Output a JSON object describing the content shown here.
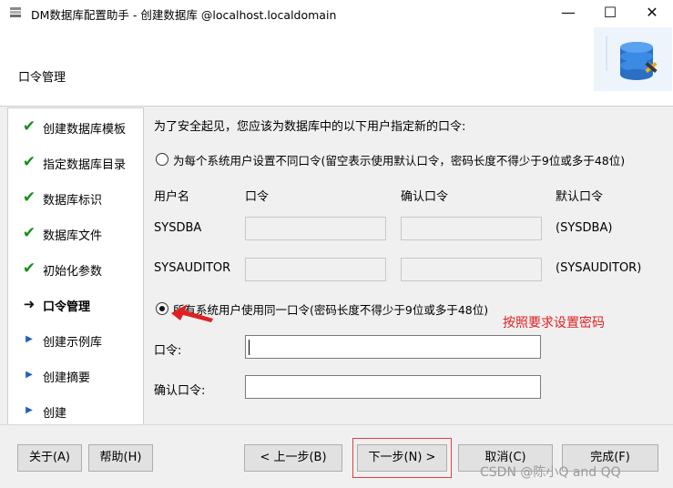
{
  "window": {
    "title": "DM数据库配置助手 - 创建数据库 @localhost.localdomain",
    "minimize": "—",
    "maximize": "☐",
    "close": "✕"
  },
  "header": {
    "title": "口令管理"
  },
  "sidebar": {
    "items": [
      {
        "label": "创建数据库模板",
        "state": "done"
      },
      {
        "label": "指定数据库目录",
        "state": "done"
      },
      {
        "label": "数据库标识",
        "state": "done"
      },
      {
        "label": "数据库文件",
        "state": "done"
      },
      {
        "label": "初始化参数",
        "state": "done"
      },
      {
        "label": "口令管理",
        "state": "current"
      },
      {
        "label": "创建示例库",
        "state": "pending"
      },
      {
        "label": "创建摘要",
        "state": "pending"
      },
      {
        "label": "创建",
        "state": "pending"
      }
    ]
  },
  "main": {
    "intro": "为了安全起见，您应该为数据库中的以下用户指定新的口令:",
    "option_individual": "为每个系统用户设置不同口令(留空表示使用默认口令，密码长度不得少于9位或多于48位)",
    "col_user": "用户名",
    "col_password": "口令",
    "col_confirm": "确认口令",
    "col_default": "默认口令",
    "users": [
      {
        "name": "SYSDBA",
        "default": "(SYSDBA)"
      },
      {
        "name": "SYSAUDITOR",
        "default": "(SYSAUDITOR)"
      }
    ],
    "option_same": "所有系统用户使用同一口令(密码长度不得少于9位或多于48位)",
    "password_label": "口令:",
    "confirm_label": "确认口令:",
    "annotation": "按照要求设置密码"
  },
  "footer": {
    "about": "关于(A)",
    "help": "帮助(H)",
    "prev": "< 上一步(B)",
    "next": "下一步(N) >",
    "cancel": "取消(C)",
    "finish": "完成(F)"
  },
  "watermark": "CSDN @陈小Q and QQ"
}
